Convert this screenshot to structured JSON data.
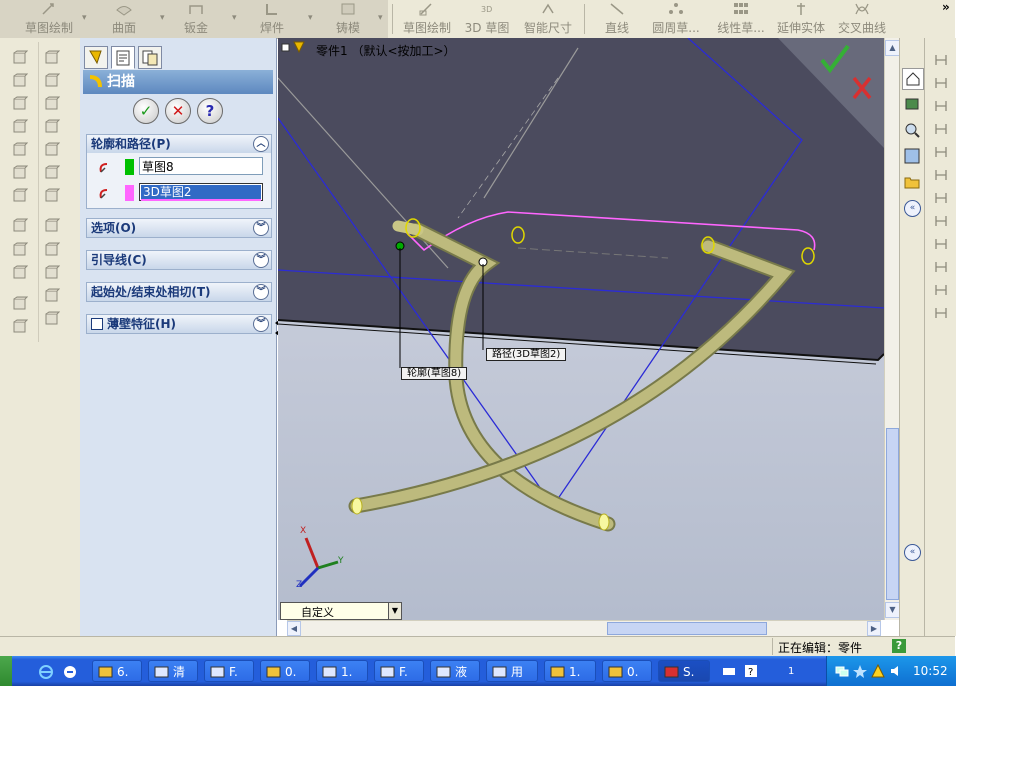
{
  "toolbar": {
    "left_group": [
      {
        "label": "草图绘制",
        "icon": "sketch-icon"
      },
      {
        "label": "曲面",
        "icon": "surface-icon"
      },
      {
        "label": "钣金",
        "icon": "sheet-metal-icon"
      },
      {
        "label": "焊件",
        "icon": "weldment-icon"
      },
      {
        "label": "铸模",
        "icon": "mold-icon"
      }
    ],
    "right_group": [
      {
        "label": "草图绘制",
        "icon": "sketch-icon"
      },
      {
        "label": "3D 草图",
        "icon": "3d-sketch-icon"
      },
      {
        "label": "智能尺寸",
        "icon": "smart-dimension-icon"
      },
      {
        "label": "直线",
        "icon": "line-icon"
      },
      {
        "label": "圆周草...",
        "icon": "circular-pattern-icon"
      },
      {
        "label": "线性草...",
        "icon": "linear-pattern-icon"
      },
      {
        "label": "延伸实体",
        "icon": "extend-entities-icon"
      },
      {
        "label": "交叉曲线",
        "icon": "intersection-curve-icon"
      }
    ],
    "overflow": "»"
  },
  "property_manager": {
    "title": "扫描",
    "ok": "✓",
    "cancel": "✕",
    "help": "?",
    "sections": {
      "profile_path": {
        "label": "轮廓和路径(P)",
        "profile_value": "草图8",
        "path_value": "3D草图2",
        "profile_color": "#00c000",
        "path_color": "#ff66ff"
      },
      "options": {
        "label": "选项(O)"
      },
      "guide_curves": {
        "label": "引导线(C)"
      },
      "tangency": {
        "label": "起始处/结束处相切(T)"
      },
      "thin_feature": {
        "label": "薄壁特征(H)"
      }
    }
  },
  "viewport": {
    "tree_item": "零件1 （默认<按加工>）",
    "callout_path": "路径(3D草图2)",
    "callout_profile": "轮廓(草图8)",
    "view_select": "自定义",
    "triad": {
      "x": "X",
      "y": "Y",
      "z": "Z"
    }
  },
  "status": {
    "text": "正在编辑：零件",
    "help": "?"
  },
  "taskbar": {
    "items": [
      {
        "label": "6.",
        "icon": "folder-icon"
      },
      {
        "label": "清",
        "icon": "app-icon"
      },
      {
        "label": "F.",
        "icon": "app-icon"
      },
      {
        "label": "0.",
        "icon": "folder-icon"
      },
      {
        "label": "1.",
        "icon": "app-icon"
      },
      {
        "label": "F.",
        "icon": "app-icon"
      },
      {
        "label": "液",
        "icon": "app-icon"
      },
      {
        "label": "用",
        "icon": "app-icon"
      },
      {
        "label": "1.",
        "icon": "folder-icon"
      },
      {
        "label": "0.",
        "icon": "folder-icon"
      },
      {
        "label": "S.",
        "icon": "solidworks-icon"
      }
    ],
    "clock": "10:52",
    "lang": "1"
  }
}
